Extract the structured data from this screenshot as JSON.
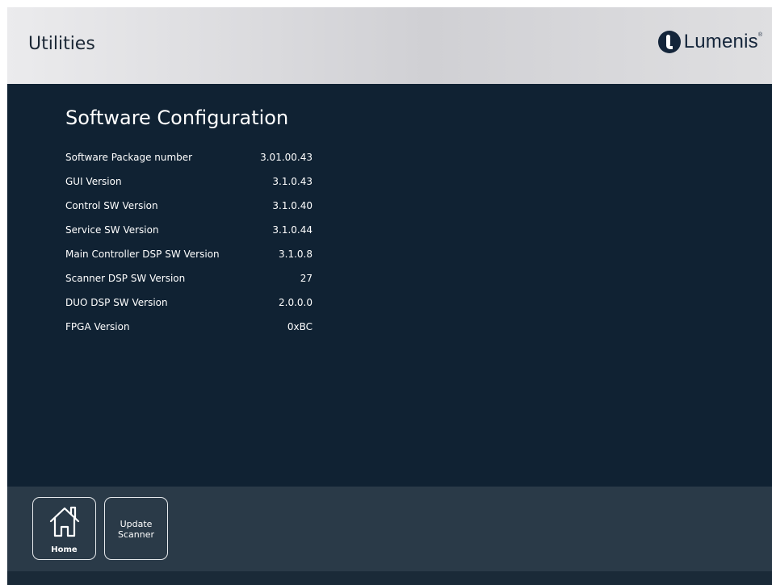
{
  "header": {
    "title": "Utilities",
    "logo": {
      "text": "Lumenis",
      "registered": "®",
      "icon": "lumenis-logo-icon"
    }
  },
  "main": {
    "section_title": "Software Configuration",
    "rows": [
      {
        "label": "Software Package number",
        "value": "3.01.00.43"
      },
      {
        "label": "GUI Version",
        "value": "3.1.0.43"
      },
      {
        "label": "Control SW Version",
        "value": "3.1.0.40"
      },
      {
        "label": "Service SW Version",
        "value": "3.1.0.44"
      },
      {
        "label": "Main Controller DSP SW Version",
        "value": "3.1.0.8"
      },
      {
        "label": "Scanner DSP SW Version",
        "value": "27"
      },
      {
        "label": "DUO DSP SW Version",
        "value": "2.0.0.0"
      },
      {
        "label": "FPGA Version",
        "value": "0xBC"
      }
    ]
  },
  "footer": {
    "home_button": {
      "label": "Home",
      "icon": "home-icon"
    },
    "update_scanner_button": {
      "line1": "Update",
      "line2": "Scanner"
    }
  },
  "colors": {
    "header_bg": "#d6d6d9",
    "main_bg": "#102233",
    "footer_bg": "#2a3a48",
    "text": "#ffffff",
    "brand": "#14253a"
  }
}
